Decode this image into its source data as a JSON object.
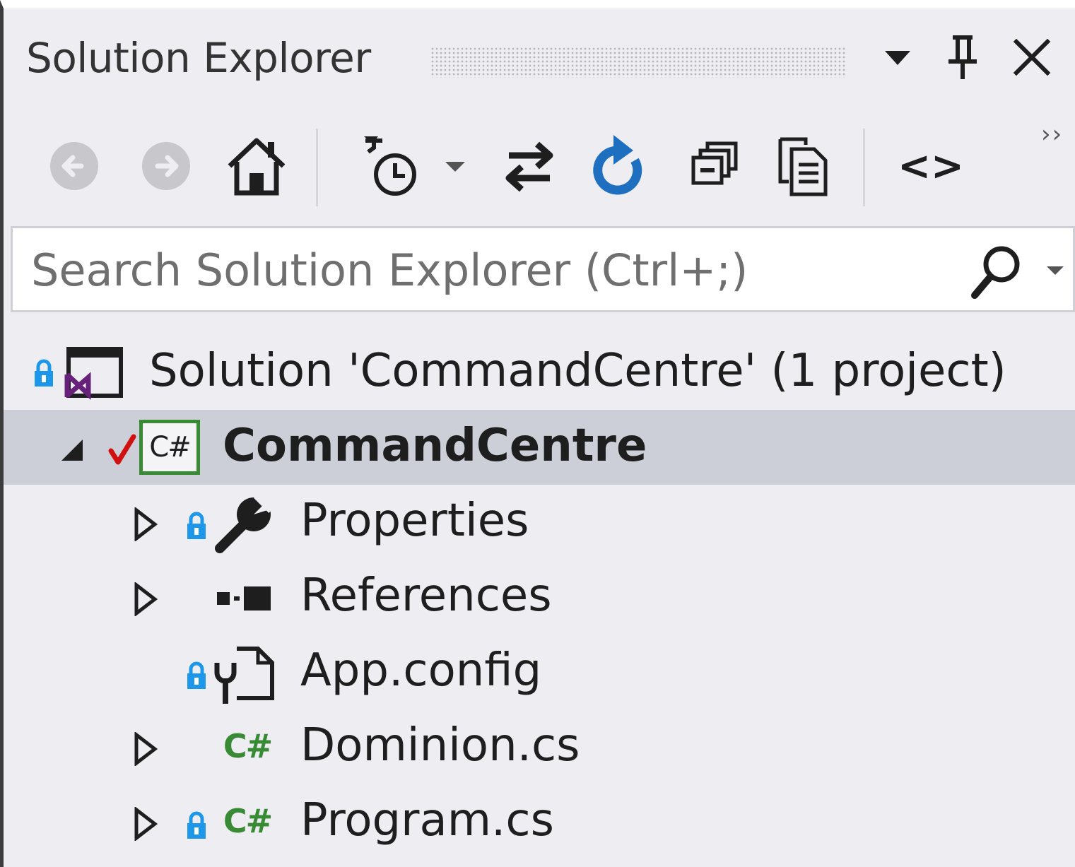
{
  "panel": {
    "title": "Solution Explorer",
    "window_position_menu_icon": "dropdown-arrow",
    "pin_icon": "pin",
    "close_icon": "close"
  },
  "toolbar": {
    "overflow_label": "››",
    "tools": [
      {
        "name": "back",
        "icon": "back-arrow-circle",
        "enabled": false
      },
      {
        "name": "forward",
        "icon": "forward-arrow-circle",
        "enabled": false
      },
      {
        "name": "home",
        "icon": "home"
      },
      {
        "name": "pending-changes-filter",
        "icon": "clock-filter"
      },
      {
        "name": "pending-changes-filter-dropdown",
        "icon": "dropdown-arrow"
      },
      {
        "name": "sync-with-active-document",
        "icon": "sync-arrows"
      },
      {
        "name": "refresh",
        "icon": "refresh"
      },
      {
        "name": "collapse-all",
        "icon": "collapse-all"
      },
      {
        "name": "show-all-files",
        "icon": "show-all-files"
      },
      {
        "name": "view-code",
        "icon": "code-brackets"
      }
    ],
    "view_code_label": "<>"
  },
  "search": {
    "placeholder": "Search Solution Explorer (Ctrl+;)",
    "value": "",
    "search_icon": "search",
    "options_icon": "dropdown-arrow"
  },
  "tree": {
    "solution": {
      "label": "Solution 'CommandCentre' (1 project)",
      "icon": "solution",
      "locked": true
    },
    "project": {
      "label": "CommandCentre",
      "icon": "csharp-project",
      "expanded": true,
      "checked_in": true,
      "selected": true,
      "icon_text": "C#"
    },
    "items": [
      {
        "label": "Properties",
        "icon": "wrench",
        "expandable": true,
        "locked": true
      },
      {
        "label": "References",
        "icon": "references",
        "expandable": true,
        "locked": false
      },
      {
        "label": "App.config",
        "icon": "config-file",
        "expandable": false,
        "locked": true
      },
      {
        "label": "Dominion.cs",
        "icon": "csharp-file",
        "expandable": true,
        "locked": false,
        "icon_text": "C#"
      },
      {
        "label": "Program.cs",
        "icon": "csharp-file",
        "expandable": true,
        "locked": true,
        "icon_text": "C#"
      }
    ]
  },
  "colors": {
    "panel_background": "#eeeef2",
    "selected_row": "#ccced8",
    "csharp_green": "#388a34",
    "lock_blue": "#1c97ea",
    "refresh_blue": "#1e6fbf",
    "vs_purple": "#68217a",
    "checkmark_red": "#d11010"
  }
}
